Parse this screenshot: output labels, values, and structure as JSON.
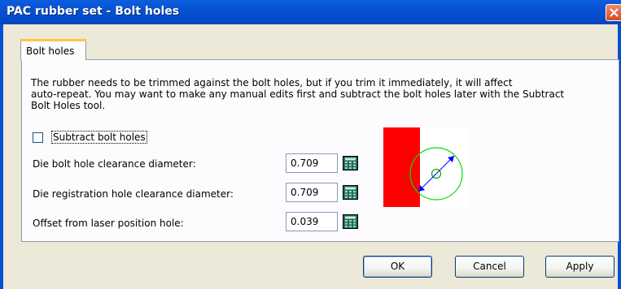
{
  "window": {
    "title": "PAC rubber set - Bolt holes"
  },
  "tabs": [
    {
      "label": "Bolt holes",
      "selected": true
    }
  ],
  "description": "The rubber needs to be trimmed against the bolt holes, but if you trim it immediately, it will affect\nauto-repeat. You may want to make any manual edits first and subtract the bolt holes later with the Subtract\nBolt Holes tool.",
  "subtract_checkbox": {
    "label": "Subtract bolt holes",
    "checked": false
  },
  "fields": [
    {
      "label": "Die bolt hole clearance diameter:",
      "value": "0.709"
    },
    {
      "label": "Die registration hole clearance diameter:",
      "value": "0.709"
    },
    {
      "label": "Offset from laser position hole:",
      "value": "0.039"
    }
  ],
  "buttons": {
    "ok": "OK",
    "cancel": "Cancel",
    "apply": "Apply"
  },
  "colors": {
    "title_bar": "#0450d0",
    "preview_rubber": "#ff0000",
    "preview_hole": "#00e000",
    "preview_arrow": "#0000ff"
  },
  "icons": {
    "close": "close-icon",
    "calculator": "calculator-icon"
  }
}
